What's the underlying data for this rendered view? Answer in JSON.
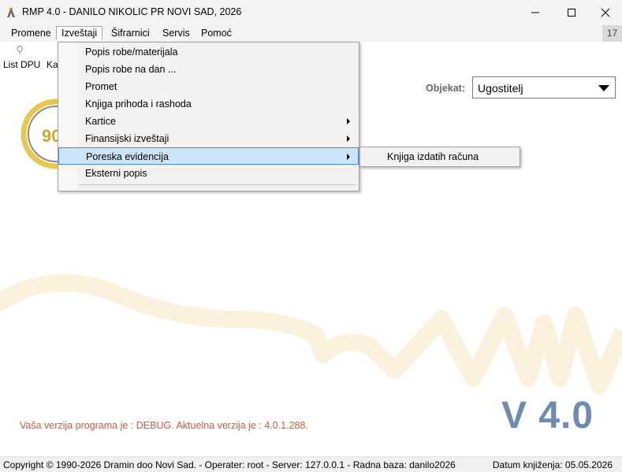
{
  "window": {
    "title": "RMP 4.0 - DANILO NIKOLIC PR NOVI SAD, 2026",
    "minimize": "—",
    "maximize": "☐",
    "close": "✕"
  },
  "menubar": {
    "items": [
      "Promene",
      "Izveštaji",
      "Šifrarnici",
      "Servis",
      "Pomoć"
    ],
    "badge": "17"
  },
  "toolbar": {
    "items": [
      "List DPU",
      "Ka"
    ]
  },
  "objekat": {
    "label": "Objekat:",
    "value": "Ugostitelj"
  },
  "dropdown": {
    "items": [
      {
        "label": "Popis robe/materijala",
        "submenu": false
      },
      {
        "label": "Popis robe na dan ...",
        "submenu": false
      },
      {
        "label": "Promet",
        "submenu": false
      },
      {
        "label": "Knjiga prihoda i rashoda",
        "submenu": false
      },
      {
        "label": "Kartice",
        "submenu": true
      },
      {
        "label": "Finansijski izveštaji",
        "submenu": true
      },
      {
        "label": "Poreska evidencija",
        "submenu": true
      },
      {
        "label": "Eksterni popis",
        "submenu": false
      }
    ],
    "highlighted": "Poreska evidencija"
  },
  "submenu": {
    "items": [
      "Knjiga izdatih računa"
    ]
  },
  "logo_partial": "90",
  "version_badge": "V 4.0",
  "debug_message": "Vaša verzija programa je : DEBUG. Aktuelna verzija je : 4.0.1.288.",
  "statusbar": {
    "left": "Copyright © 1990-2026 Dramin doo Novi Sad. - Operater: root - Server: 127.0.0.1 - Radna baza: danilo2026",
    "right": "Datum knjiženja: 05.05.2026"
  },
  "colors": {
    "highlight_bg": "#cce4f7",
    "highlight_border": "#3d8ee0",
    "debug_text": "#e0573a",
    "version_text": "#6d8cb3"
  }
}
